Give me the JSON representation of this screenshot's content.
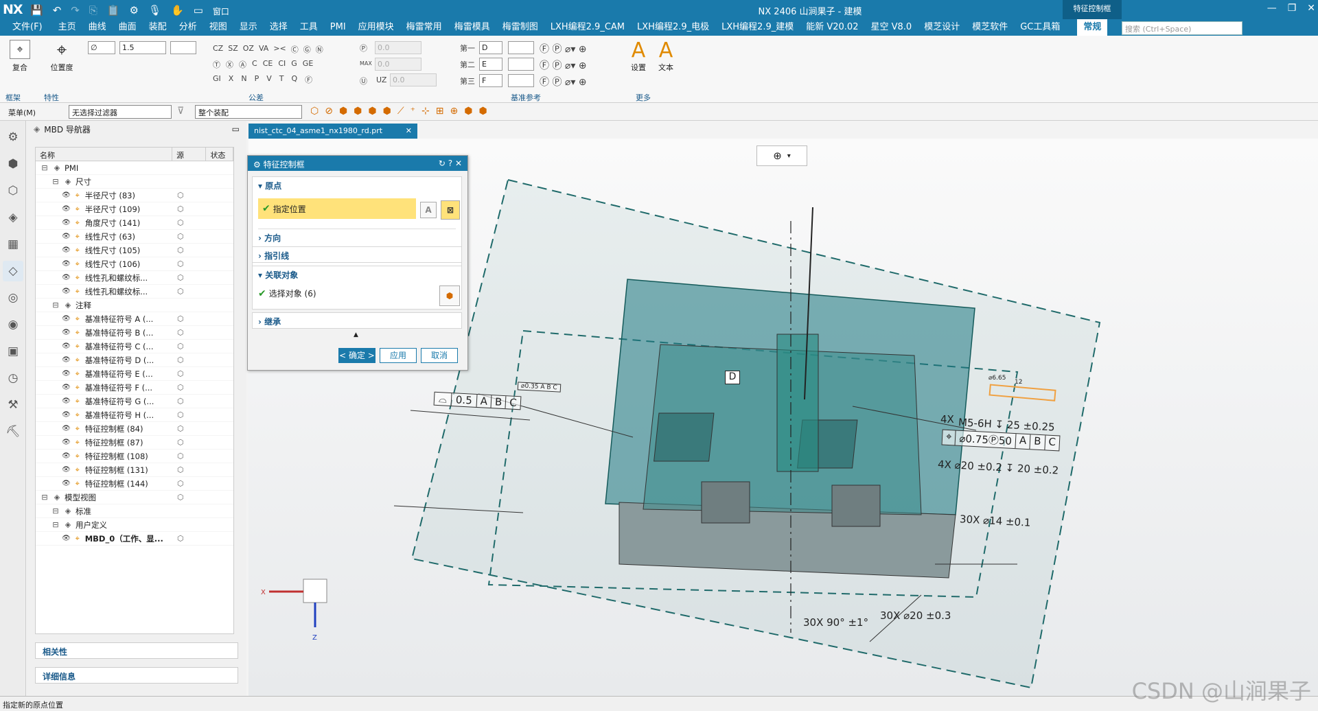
{
  "app": {
    "logo": "NX",
    "title": "NX 2406 山涧果子 - 建模",
    "context_tab": "特征控制框",
    "window_menu": "窗口"
  },
  "menu": [
    "文件(F)",
    "主页",
    "曲线",
    "曲面",
    "装配",
    "分析",
    "视图",
    "显示",
    "选择",
    "工具",
    "PMI",
    "应用模块",
    "梅雷常用",
    "梅雷模具",
    "梅雷制图",
    "LXH编程2.9_CAM",
    "LXH编程2.9_电极",
    "LXH编程2.9_建模",
    "能新 V20.02",
    "星空 V8.0",
    "模芝设计",
    "模芝软件",
    "GC工具箱",
    "常规"
  ],
  "search_placeholder": "搜索 (Ctrl+Space)",
  "ribbon": {
    "composite": "复合",
    "position": "位置度",
    "group_frame": "框架",
    "group_feature": "特性",
    "group_tolerance": "公差",
    "group_datum": "基准参考",
    "group_more": "更多",
    "diameter_symbol": "∅",
    "tolerance_value": "1.5",
    "sym_row1": [
      "CZ",
      "SZ",
      "OZ",
      "VA",
      "><",
      "Ⓒ",
      "Ⓖ",
      "Ⓝ"
    ],
    "sym_row2": [
      "Ⓣ",
      "Ⓧ",
      "Ⓐ",
      "C",
      "CE",
      "CI",
      "G",
      "GE"
    ],
    "sym_row3": [
      "GI",
      "X",
      "N",
      "P",
      "V",
      "T",
      "Q",
      "Ⓕ"
    ],
    "p_value": "0.0",
    "max_label": "MAX",
    "max_value": "0.0",
    "uz_label": "UZ",
    "uz_value": "0.0",
    "datum1_label": "第一",
    "datum1": "D",
    "datum2_label": "第二",
    "datum2": "E",
    "datum3_label": "第三",
    "datum3": "F",
    "settings": "设置",
    "text": "文本"
  },
  "toolbar2": {
    "menu": "菜单(M)",
    "filter": "无选择过滤器",
    "scope": "整个装配"
  },
  "navigator": {
    "title": "MBD 导航器",
    "col_name": "名称",
    "col_source": "源",
    "col_status": "状态",
    "rows": [
      {
        "label": "PMI",
        "indent": 0
      },
      {
        "label": "尺寸",
        "indent": 1
      },
      {
        "label": "半径尺寸 (83)",
        "indent": 2
      },
      {
        "label": "半径尺寸 (109)",
        "indent": 2
      },
      {
        "label": "角度尺寸 (141)",
        "indent": 2
      },
      {
        "label": "线性尺寸 (63)",
        "indent": 2
      },
      {
        "label": "线性尺寸 (105)",
        "indent": 2
      },
      {
        "label": "线性尺寸 (106)",
        "indent": 2
      },
      {
        "label": "线性孔和螺纹标...",
        "indent": 2
      },
      {
        "label": "线性孔和螺纹标...",
        "indent": 2
      },
      {
        "label": "注释",
        "indent": 1
      },
      {
        "label": "基准特征符号 A (...",
        "indent": 2
      },
      {
        "label": "基准特征符号 B (...",
        "indent": 2
      },
      {
        "label": "基准特征符号 C (...",
        "indent": 2
      },
      {
        "label": "基准特征符号 D (...",
        "indent": 2
      },
      {
        "label": "基准特征符号 E (...",
        "indent": 2
      },
      {
        "label": "基准特征符号 F (...",
        "indent": 2
      },
      {
        "label": "基准特征符号 G (...",
        "indent": 2
      },
      {
        "label": "基准特征符号 H (...",
        "indent": 2
      },
      {
        "label": "特征控制框 (84)",
        "indent": 2
      },
      {
        "label": "特征控制框 (87)",
        "indent": 2
      },
      {
        "label": "特征控制框 (108)",
        "indent": 2
      },
      {
        "label": "特征控制框 (131)",
        "indent": 2
      },
      {
        "label": "特征控制框 (144)",
        "indent": 2
      },
      {
        "label": "模型视图",
        "indent": 0
      },
      {
        "label": "标准",
        "indent": 1
      },
      {
        "label": "用户定义",
        "indent": 1
      },
      {
        "label": "MBD_0（工作、显...",
        "indent": 2
      }
    ],
    "relevance": "相关性",
    "details": "详细信息"
  },
  "doc_tab": "nist_ctc_04_asme1_nx1980_rd.prt",
  "dialog": {
    "title": "特征控制框",
    "origin": "原点",
    "specify_location": "指定位置",
    "direction": "方向",
    "leader": "指引线",
    "associated": "关联对象",
    "select_objects": "选择对象 (6)",
    "inherit": "继承",
    "ok": "< 确定 >",
    "apply": "应用",
    "cancel": "取消"
  },
  "annotations": {
    "fcf_left": [
      "0.5",
      "A",
      "B",
      "C"
    ],
    "fcf_top": "⌀0.35 A B C",
    "datum_d": "D",
    "hole_4x": "4X",
    "thread": "M5-6H ↧ 25  ±0.25",
    "fcf_right": [
      "⌀0.75Ⓟ50",
      "A",
      "B",
      "C"
    ],
    "hole2": "4X  ⌀20  ±0.2 ↧ 20  ±0.2",
    "hole3": "30X  ⌀14  ±0.1",
    "angle": "30X  90°  ±1°",
    "hole4": "30X  ⌀20  ±0.3",
    "dim_12": "12",
    "dim_665": "⌀6.65"
  },
  "axes": {
    "x": "X",
    "z": "Z"
  },
  "status": "指定新的原点位置",
  "watermark": "CSDN @山涧果子"
}
